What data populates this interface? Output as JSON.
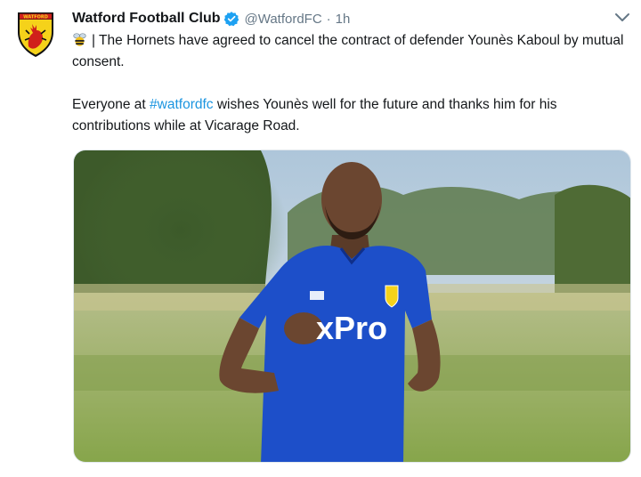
{
  "tweet": {
    "author": {
      "display_name": "Watford Football Club",
      "handle": "@WatfordFC",
      "verified": true,
      "avatar_icon": "watford-crest-icon",
      "crest_text": "WATFORD"
    },
    "separator": "·",
    "timestamp": "1h",
    "menu_icon": "chevron-down-icon",
    "body": {
      "line1_emoji": "bee-icon",
      "line1_text": "| The Hornets have agreed to cancel the contract of defender Younès Kaboul by mutual consent.",
      "line2_prefix": "Everyone at ",
      "hashtag": "#watfordfc",
      "line2_suffix": " wishes Younès well for the future and thanks him for his contributions while at Vicarage Road."
    },
    "media": {
      "jersey_sponsor": "xPro",
      "colors": {
        "shirt": "#1d4fc9",
        "sky": "#c7d6e4",
        "grass": "#9fb46a",
        "trees": "#3f5a2c"
      }
    }
  },
  "colors": {
    "text": "#14171a",
    "secondary_text": "#657786",
    "link": "#1b95e0",
    "verified": "#1da1f2",
    "crest_yellow": "#f5d21a",
    "crest_red": "#d0201b",
    "crest_black": "#111111"
  }
}
